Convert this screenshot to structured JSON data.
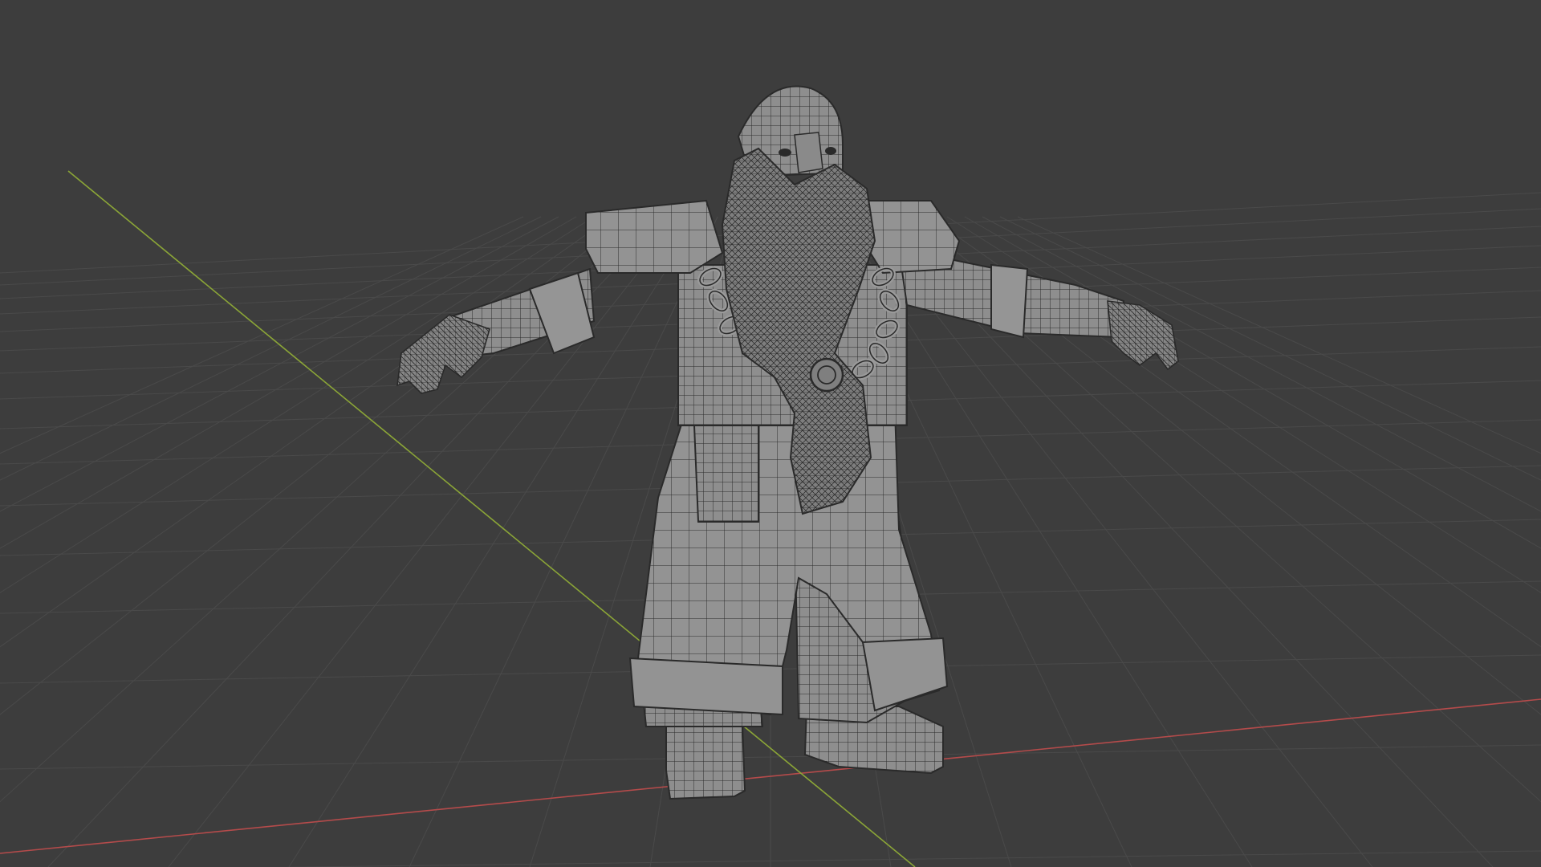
{
  "viewport": {
    "type": "3d-viewport",
    "shading": "solid-with-wireframe-overlay",
    "background_color": "#3d3d3d",
    "grid_color": "#4a4a4a",
    "x_axis_color": "#b54b4b",
    "y_axis_color": "#8ba537",
    "mesh_fill_color": "#8e8e8e",
    "mesh_shadow_color": "#6b6b6b",
    "wire_color": "#2c2c2c",
    "subject": "dwarf-character-mesh-t-pose"
  }
}
